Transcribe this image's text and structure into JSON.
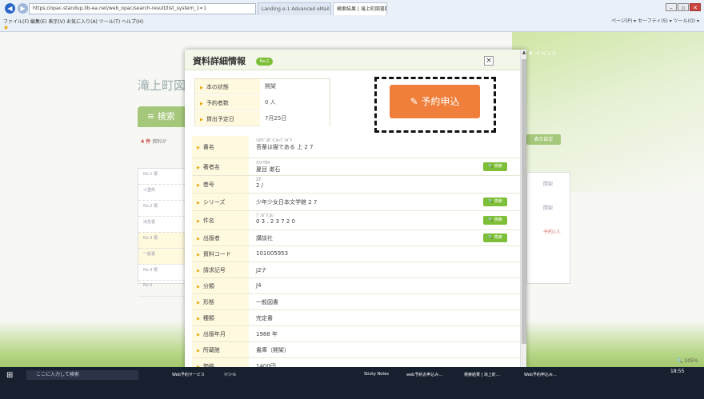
{
  "browser": {
    "url": "https://opac-standup.lib-ea.net/web_opac/search-result/list_system_1=1",
    "tabs": [
      {
        "label": "Landing e-1 Advanced eMail..."
      },
      {
        "label": "検索結果 | 滝上町図書館"
      }
    ],
    "menu": "ファイル(F)  編集(E)  表示(V)  お気に入り(A)  ツール(T)  ヘルプ(H)",
    "toolbar": "ページ(P) ▾  セーフティ(S) ▾  ツール(O) ▾"
  },
  "page": {
    "site_title": "滝上町図書館",
    "search_label": "≡ 検索",
    "hits": "4 件",
    "hits_sub": "資料が",
    "display_settings": "表示設定",
    "event": "♦ イベント",
    "list_items": [
      "No.1   著",
      "三重県",
      "No.2   著",
      "滝島書",
      "No.3   著",
      "一般書",
      "No.4   著",
      "No.5"
    ],
    "right_vals": [
      "開架",
      "開架",
      "予約1人"
    ],
    "zoom": "🔍 105%"
  },
  "modal": {
    "title": "資料詳細情報",
    "badge": "No.2",
    "status": [
      {
        "label": "本の状態",
        "value": "開架"
      },
      {
        "label": "予約者数",
        "value": "0 人"
      },
      {
        "label": "貸出予定日",
        "value": "7月25日"
      }
    ],
    "reserve_button": "✎  予約申込",
    "details": [
      {
        "label": "書名",
        "kana": "ｼﾖｳｼﾞﾖﾀﾞｲﾆﾎﾝﾌﾞﾝｶﾞｸ",
        "value": "吾輩は猫である  上  2 7",
        "search": ""
      },
      {
        "label": "著者名",
        "kana": "ﾅﾂﾒｿｳｾｷ",
        "value": "夏目  漱石",
        "search": "🔍 検索"
      },
      {
        "label": "巻号",
        "kana": "27",
        "value": "2 /",
        "search": ""
      },
      {
        "label": "シリーズ",
        "kana": "",
        "value": "少年少女日本文学館  2 7",
        "search": "🔍 検索"
      },
      {
        "label": "件名",
        "kana": "ﾌﾞﾝｶﾞｸﾆﾎﾝ",
        "value": "0 3 .  2      3 7 2 0",
        "search": "🔍 検索"
      },
      {
        "label": "出版者",
        "kana": "",
        "value": "講談社",
        "search": "🔍 検索"
      },
      {
        "label": "資料コード",
        "kana": "",
        "value": "101005953",
        "search": ""
      },
      {
        "label": "請求記号",
        "kana": "",
        "value": "J2ナ",
        "search": ""
      },
      {
        "label": "分類",
        "kana": "",
        "value": "J4",
        "search": ""
      },
      {
        "label": "形態",
        "kana": "",
        "value": "  一般図書",
        "search": ""
      },
      {
        "label": "種類",
        "kana": "",
        "value": "完定書",
        "search": ""
      },
      {
        "label": "出版年月",
        "kana": "",
        "value": "1988 年",
        "search": ""
      },
      {
        "label": "所蔵館",
        "kana": "",
        "value": "書庫（開架）",
        "search": ""
      },
      {
        "label": "価格",
        "kana": "",
        "value": "1400円",
        "search": ""
      }
    ]
  },
  "taskbar": {
    "search": "ここに入力して検索",
    "items": [
      "Web予約サービス",
      "ﾏｲﾌｧｲﾙ",
      "Sticky Notes",
      "web予約お申込み…",
      "検索結果 | 滝上町…",
      "Web予約申込み…"
    ],
    "clock": "18:55"
  }
}
